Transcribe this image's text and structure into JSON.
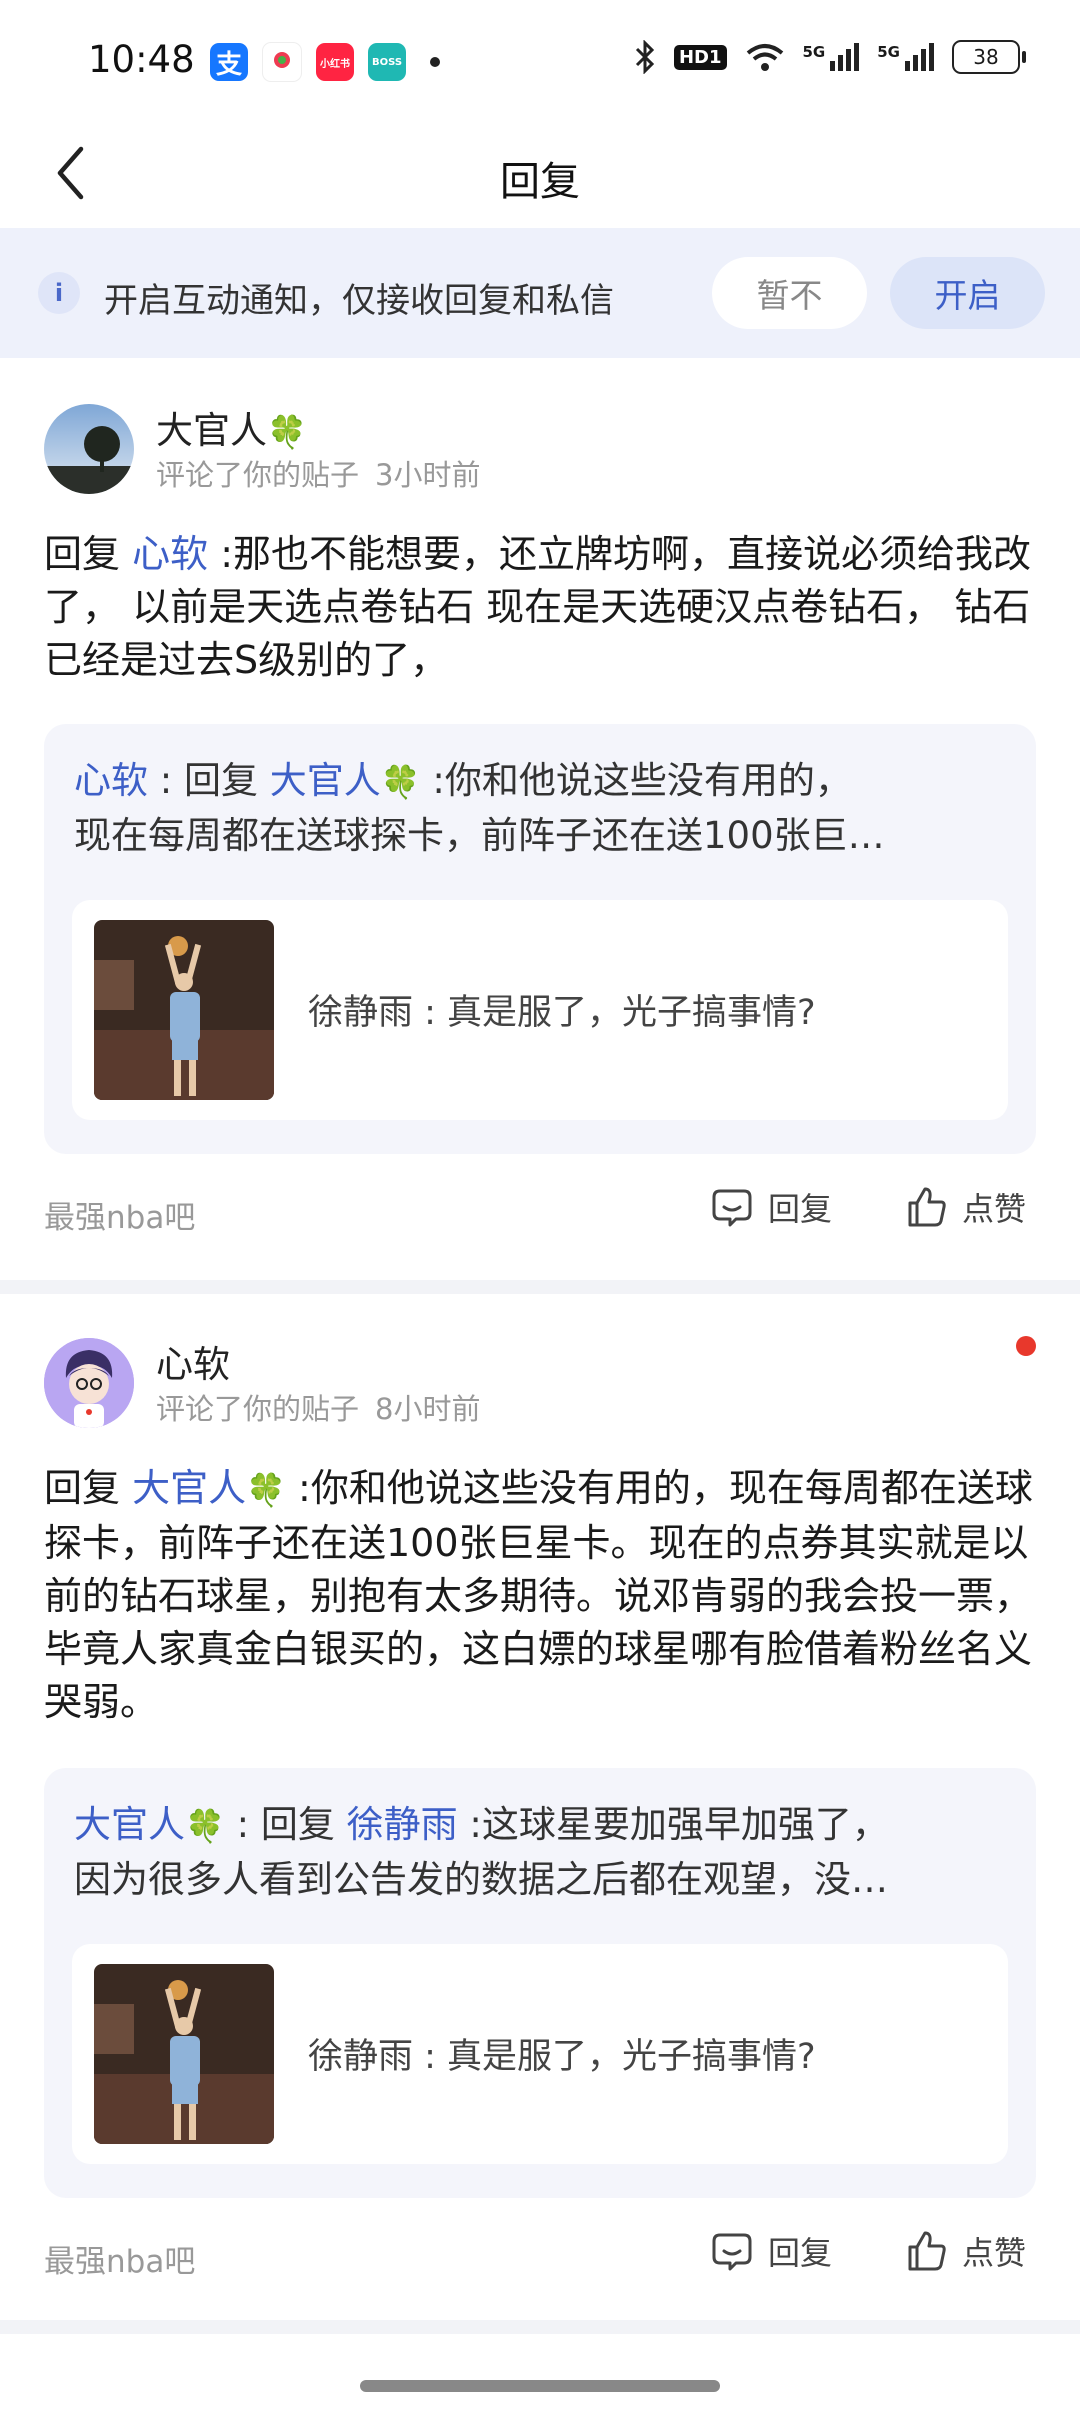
{
  "status_bar": {
    "time": "10:48",
    "apps": [
      {
        "icon": "alipay-icon",
        "color": "#1677ff",
        "label": "支"
      },
      {
        "icon": "china-mobile-icon",
        "color": "#ef3b52",
        "label": ""
      },
      {
        "icon": "xiaohongshu-icon",
        "color": "#ff2442",
        "label": "小红书"
      },
      {
        "icon": "boss-zhipin-icon",
        "color": "#1fb8b3",
        "label": "BOSS"
      }
    ],
    "signal_5g_1": "5G",
    "signal_5g_2": "5G",
    "hd": "HD1",
    "battery": "38"
  },
  "header": {
    "title": "回复"
  },
  "notice": {
    "text": "开启互动通知，仅接收回复和私信",
    "later_label": "暂不",
    "enable_label": "开启"
  },
  "cards": [
    {
      "user": "大官人",
      "action_text": "评论了你的贴子",
      "time": "3小时前",
      "reply_prefix": "回复",
      "reply_to": "心软",
      "body": " :那也不能想要，还立牌坊啊，直接说必须给我改了， 以前是天选点卷钻石 现在是天选硬汉点卷钻石， 钻石已经是过去S级别的了，",
      "quote": {
        "author": "心软",
        "sep": " : 回复 ",
        "target": "大官人",
        "line1_rest": " :你和他说这些没有用的，",
        "line2": "现在每周都在送球探卡，前阵子还在送100张巨…"
      },
      "post": {
        "author": "徐静雨",
        "text": " : 真是服了，光子搞事情?"
      },
      "forum": "最强nba吧",
      "reply_label": "回复",
      "like_label": "点赞",
      "unread": false
    },
    {
      "user": "心软",
      "action_text": "评论了你的贴子",
      "time": "8小时前",
      "reply_prefix": "回复",
      "reply_to": "大官人",
      "body": " :你和他说这些没有用的，现在每周都在送球探卡，前阵子还在送100张巨星卡。现在的点券其实就是以前的钻石球星，别抱有太多期待。说邓肯弱的我会投一票，毕竟人家真金白银买的，这白嫖的球星哪有脸借着粉丝名义哭弱。",
      "quote": {
        "author": "大官人",
        "sep": " : 回复 ",
        "target": "徐静雨",
        "line1_rest": " :这球星要加强早加强了，",
        "line2": "因为很多人看到公告发的数据之后都在观望，没…"
      },
      "post": {
        "author": "徐静雨",
        "text": " : 真是服了，光子搞事情?"
      },
      "forum": "最强nba吧",
      "reply_label": "回复",
      "like_label": "点赞",
      "unread": true
    }
  ],
  "colors": {
    "accent": "#3d5fc7",
    "notice_bg": "#eef1fb",
    "quote_bg": "#f4f5fb",
    "unread_dot": "#e8382c"
  }
}
